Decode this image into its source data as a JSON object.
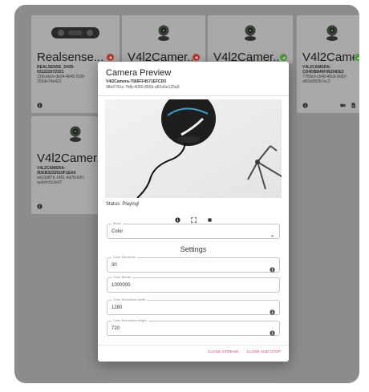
{
  "cards": [
    {
      "title": "Realsense...",
      "line1": "REALSENSE_D435-\n021222072331",
      "line2": "219cebce-de94-4b45-91f9-\n253de74e422",
      "status": "error",
      "variant": "realsense"
    },
    {
      "title": "V4l2Camer...",
      "line1": "",
      "line2": "",
      "status": "error",
      "variant": "camera"
    },
    {
      "title": "V4l2Camer...",
      "line1": "",
      "line2": "",
      "status": "ok",
      "variant": "camera"
    },
    {
      "title": "V4l2Camer...",
      "line1": "V4L2CAMERA-\nCD4DBB46F9ED4DE2",
      "line2": "77f5bcf-cb48-45c6-9d52-\naf55d992b7ec2",
      "status": "ok",
      "variant": "camera"
    },
    {
      "title": "V4l2Camer...",
      "line1": "V4L2CAMERA-\n9DEB3232610F1EA0",
      "line2": "ed23d879-1451-4d78-b9f1\naa9efc5c2e97",
      "status": "none",
      "variant": "camera"
    }
  ],
  "dialog": {
    "title": "Camera Preview",
    "device_id": "V4l2Camera-7566FF4571EFCD0",
    "uuid": "98e6791e-7fdb-4050-850b-a82a6e125a9",
    "status": "Status: Playing!",
    "mode": {
      "label": "Mode",
      "value": "Color"
    },
    "settings_heading": "Settings",
    "fields": [
      {
        "label": "Color framerate",
        "value": "30",
        "info": true
      },
      {
        "label": "Color Bitrate",
        "value": "1000000",
        "info": false
      },
      {
        "label": "Color Resolution width",
        "value": "1280",
        "info": true
      },
      {
        "label": "Color Resolution height",
        "value": "720",
        "info": true
      }
    ],
    "close_stream": "CLOSE STREAM",
    "close_and_stop": "CLOSE AND STOP"
  },
  "colors": {
    "accent": "#d6385f",
    "error": "#b93a2e",
    "ok": "#4e9a3c",
    "overlay": "#8c8c8c"
  }
}
